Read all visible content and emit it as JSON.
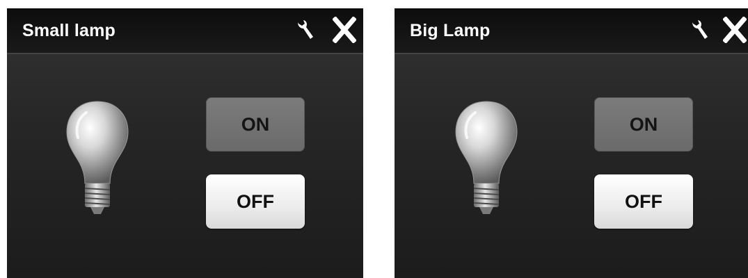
{
  "colors": {
    "panel_bg": "#262626",
    "titlebar_bg": "#111111",
    "title_text": "#ffffff",
    "on_button_bg": "#727272",
    "off_button_bg": "#f2f2f2"
  },
  "panels": [
    {
      "title": "Small lamp",
      "icons": {
        "settings": "wrench-icon",
        "close": "close-icon",
        "lamp": "light-bulb-icon"
      },
      "on_label": "ON",
      "off_label": "OFF"
    },
    {
      "title": "Big Lamp",
      "icons": {
        "settings": "wrench-icon",
        "close": "close-icon",
        "lamp": "light-bulb-icon"
      },
      "on_label": "ON",
      "off_label": "OFF"
    }
  ]
}
